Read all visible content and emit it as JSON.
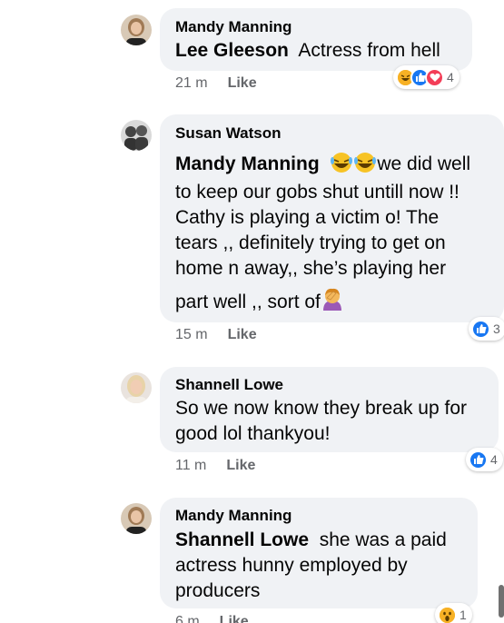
{
  "comments": [
    {
      "author": "Mandy Manning",
      "mention": "Lee Gleeson",
      "text": "Actress from hell",
      "time": "21 m",
      "like": "Like",
      "reactions": [
        "haha-icon",
        "like-icon",
        "love-icon"
      ],
      "reaction_count": "4"
    },
    {
      "author": "Susan Watson",
      "mention": "Mandy Manning",
      "line1": "we did well",
      "line2": "to keep our gobs shut untill now !!",
      "line3": "Cathy is playing a victim o! The",
      "line4": "tears ,, definitely trying to get on",
      "line5": "home n away,, she’s playing her",
      "line6": "part well ,, sort of",
      "time": "15 m",
      "like": "Like",
      "reactions": [
        "like-icon"
      ],
      "reaction_count": "3"
    },
    {
      "author": "Shannell Lowe",
      "line1": "So we now know they break up for",
      "line2": "good lol thankyou!",
      "time": "11 m",
      "like": "Like",
      "reactions": [
        "like-icon"
      ],
      "reaction_count": "4"
    },
    {
      "author": "Mandy Manning",
      "mention": "Shannell Lowe",
      "line1": "she was a paid",
      "line2": "actress hunny employed by",
      "line3": "producers",
      "time": "6 m",
      "like": "Like",
      "reactions": [
        "wow-icon"
      ],
      "reaction_count": "1"
    }
  ],
  "colors": {
    "bubble": "#f0f2f5",
    "meta": "#65676b",
    "like_blue": "#1877f2",
    "love_red": "#f33e58",
    "haha_yellow": "#f7b125"
  }
}
